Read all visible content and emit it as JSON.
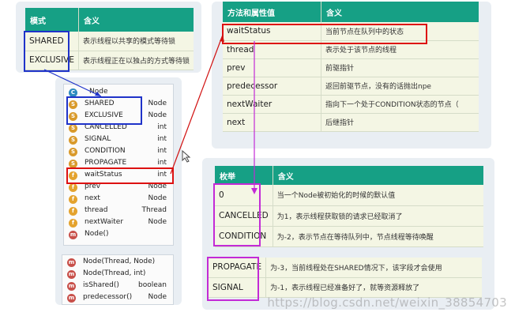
{
  "table_mode": {
    "headers": [
      "模式",
      "含义"
    ],
    "rows": [
      {
        "name": "SHARED",
        "desc": "表示线程以共享的模式等待锁"
      },
      {
        "name": "EXCLUSIVE",
        "desc": "表示线程正在以独占的方式等待锁"
      }
    ]
  },
  "table_methods": {
    "headers": [
      "方法和属性值",
      "含义"
    ],
    "rows": [
      {
        "name": "waitStatus",
        "desc": "当前节点在队列中的状态"
      },
      {
        "name": "thread",
        "desc": "表示处于该节点的线程"
      },
      {
        "name": "prev",
        "desc": "前驱指针"
      },
      {
        "name": "predecessor",
        "desc": "返回前驱节点，没有的话抛出npe"
      },
      {
        "name": "nextWaiter",
        "desc": "指向下一个处于CONDITION状态的节点（"
      },
      {
        "name": "next",
        "desc": "后继指针"
      }
    ]
  },
  "table_enum": {
    "headers": [
      "枚举",
      "含义"
    ],
    "rows": [
      {
        "name": "0",
        "desc": "当一个Node被初始化的时候的默认值"
      },
      {
        "name": "CANCELLED",
        "desc": "为1，表示线程获取锁的请求已经取消了"
      },
      {
        "name": "CONDITION",
        "desc": "为-2，表示节点在等待队列中，节点线程等待唤醒"
      },
      {
        "name": "PROPAGATE",
        "desc": "为-3，当前线程处在SHARED情况下，该字段才会使用"
      },
      {
        "name": "SIGNAL",
        "desc": "为-1，表示线程已经准备好了，就等资源释放了"
      }
    ]
  },
  "outline": {
    "class_name": "Node",
    "fields": [
      {
        "name": "SHARED",
        "type": "Node",
        "icon": "static-field-icon"
      },
      {
        "name": "EXCLUSIVE",
        "type": "Node",
        "icon": "static-field-icon"
      },
      {
        "name": "CANCELLED",
        "type": "int",
        "icon": "static-field-icon"
      },
      {
        "name": "SIGNAL",
        "type": "int",
        "icon": "static-field-icon"
      },
      {
        "name": "CONDITION",
        "type": "int",
        "icon": "static-field-icon"
      },
      {
        "name": "PROPAGATE",
        "type": "int",
        "icon": "static-field-icon"
      },
      {
        "name": "waitStatus",
        "type": "int",
        "icon": "field-icon"
      },
      {
        "name": "prev",
        "type": "Node",
        "icon": "field-icon"
      },
      {
        "name": "next",
        "type": "Node",
        "icon": "field-icon"
      },
      {
        "name": "thread",
        "type": "Thread",
        "icon": "field-icon"
      },
      {
        "name": "nextWaiter",
        "type": "Node",
        "icon": "field-icon"
      },
      {
        "name": "Node()",
        "type": "",
        "icon": "method-icon"
      }
    ],
    "methods": [
      {
        "name": "Node(Thread, Node)",
        "type": "",
        "icon": "method-icon"
      },
      {
        "name": "Node(Thread, int)",
        "type": "",
        "icon": "method-icon"
      },
      {
        "name": "isShared()",
        "type": "boolean",
        "icon": "method-icon"
      },
      {
        "name": "predecessor()",
        "type": "Node",
        "icon": "method-icon"
      }
    ]
  },
  "watermark": "https://blog.csdn.net/weixin_38854703",
  "colors": {
    "header_green": "#16a085",
    "highlight_blue": "#1f33c9",
    "highlight_red": "#d11111",
    "highlight_magenta": "#c32ad6"
  }
}
